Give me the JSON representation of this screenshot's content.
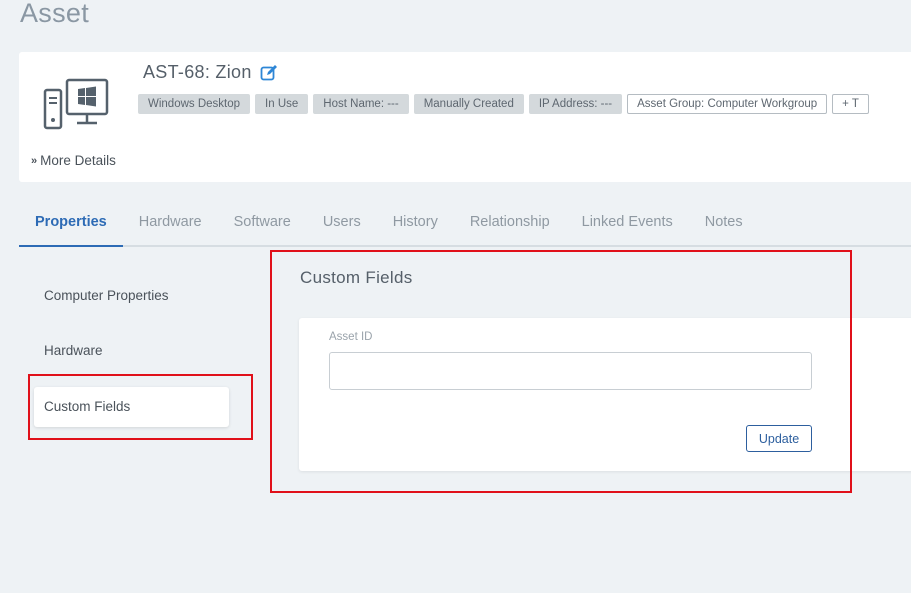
{
  "page": {
    "title": "Asset"
  },
  "asset": {
    "name": "AST-68: Zion",
    "icon": "windows-desktop-icon",
    "badges": [
      {
        "label": "Windows Desktop",
        "style": "filled"
      },
      {
        "label": "In Use",
        "style": "filled"
      },
      {
        "label": "Host Name: ---",
        "style": "filled"
      },
      {
        "label": "Manually Created",
        "style": "filled"
      },
      {
        "label": "IP Address: ---",
        "style": "filled"
      },
      {
        "label": "Asset Group: Computer Workgroup",
        "style": "outline"
      },
      {
        "label": "+ T",
        "style": "outline"
      }
    ],
    "more_details": "More Details"
  },
  "tabs": [
    {
      "label": "Properties",
      "active": true
    },
    {
      "label": "Hardware",
      "active": false
    },
    {
      "label": "Software",
      "active": false
    },
    {
      "label": "Users",
      "active": false
    },
    {
      "label": "History",
      "active": false
    },
    {
      "label": "Relationship",
      "active": false
    },
    {
      "label": "Linked Events",
      "active": false
    },
    {
      "label": "Notes",
      "active": false
    }
  ],
  "sidebar": {
    "items": [
      {
        "label": "Computer Properties",
        "selected": false
      },
      {
        "label": "Hardware",
        "selected": false
      },
      {
        "label": "Custom Fields",
        "selected": true
      }
    ]
  },
  "custom_fields": {
    "title": "Custom Fields",
    "field_label": "Asset ID",
    "field_value": "",
    "update_label": "Update"
  },
  "colors": {
    "accent": "#2d6bb5",
    "highlight": "#e0101a",
    "badge_bg": "#d4d9dc",
    "page_bg": "#eef2f5"
  }
}
